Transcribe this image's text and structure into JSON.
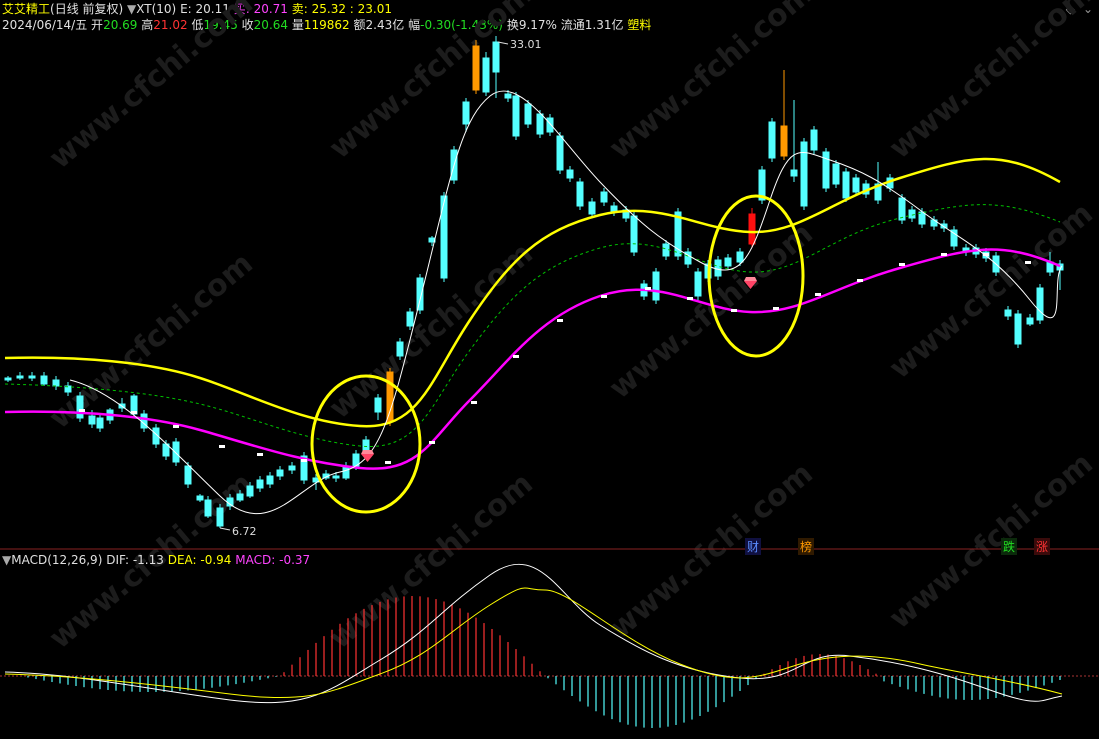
{
  "header": {
    "stock_name": "艾艾精工",
    "period": "(日线 前复权)",
    "indicator_name": "XT(10)",
    "e_label": "E: ",
    "e_value": "20.11",
    "buy_label": "买: ",
    "buy_value": "20.71",
    "sell_label": "卖: ",
    "sell_value": "25.32 : 23.01"
  },
  "quote": {
    "date": "2024/06/14/五",
    "open_label": "开",
    "open": "20.69",
    "high_label": "高",
    "high": "21.02",
    "low_label": "低",
    "low": "19.45",
    "close_label": "收",
    "close": "20.64",
    "volume_label": "量",
    "volume": "119862",
    "amount_label": "额",
    "amount": "2.43亿",
    "change_label": "幅",
    "change": "-0.30(-1.43%)",
    "turnover_label": "换",
    "turnover": "9.17%",
    "float_label": "流通",
    "float": "1.31亿",
    "sector": "塑料"
  },
  "price_chart": {
    "max_label": "33.01",
    "min_label": "6.72",
    "watermark": "www.cfchi.com"
  },
  "event_tags": [
    {
      "text": "财",
      "color": "#3c6cff"
    },
    {
      "text": "榜",
      "color": "#ff8c00"
    },
    {
      "text": "跌",
      "color": "#22cc22"
    },
    {
      "text": "涨",
      "color": "#ff3333"
    }
  ],
  "macd": {
    "name": "MACD(12,26,9)",
    "dif_label": "DIF: ",
    "dif": "-1.13",
    "dea_label": "DEA: ",
    "dea": "-0.94",
    "macd_label": "MACD: ",
    "macd": "-0.37"
  },
  "colors": {
    "up": "#ff3232",
    "down": "#54ffff",
    "band_upper": "#ffff00",
    "band_mid": "#00c000",
    "band_lower": "#ff00ff",
    "highlight_bar": "#ff9900",
    "signal_bar": "#ff1010",
    "circle": "#ffff00",
    "dif_line": "#ffffff",
    "dea_line": "#ffff00"
  },
  "chart_data": {
    "type": "candlestick",
    "y_price_range": [
      6.72,
      33.01
    ],
    "max_price": 33.01,
    "min_price": 6.72,
    "macd_values": {
      "dif": -1.13,
      "dea": -0.94,
      "macd": -0.37
    }
  }
}
